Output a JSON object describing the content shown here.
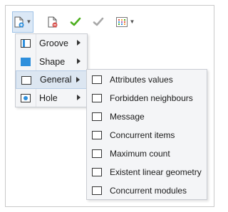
{
  "colors": {
    "accent": "#2e8fdc",
    "menu_bg": "#f4f5f7",
    "highlight": "#dce6f1",
    "check_green": "#4caf1e",
    "check_grey": "#a8a8a8"
  },
  "toolbar": {
    "buttons": [
      {
        "icon": "add-document-icon",
        "has_dropdown": true,
        "active": true
      },
      {
        "icon": "remove-document-icon",
        "has_dropdown": false
      },
      {
        "icon": "green-check-icon",
        "has_dropdown": false
      },
      {
        "icon": "grey-check-icon",
        "has_dropdown": false
      },
      {
        "icon": "grid-select-icon",
        "has_dropdown": true
      }
    ]
  },
  "menu": {
    "items": [
      {
        "label": "Groove",
        "icon": "groove-icon",
        "has_submenu": true
      },
      {
        "label": "Shape",
        "icon": "shape-icon",
        "has_submenu": true
      },
      {
        "label": "General",
        "icon": "general-icon",
        "has_submenu": true,
        "highlighted": true
      },
      {
        "label": "Hole",
        "icon": "hole-icon",
        "has_submenu": true
      }
    ]
  },
  "submenu": {
    "items": [
      {
        "label": "Attributes values",
        "icon": "rectangle-icon"
      },
      {
        "label": "Forbidden neighbours",
        "icon": "rectangle-icon"
      },
      {
        "label": "Message",
        "icon": "rectangle-icon"
      },
      {
        "label": "Concurrent items",
        "icon": "rectangle-icon"
      },
      {
        "label": "Maximum count",
        "icon": "rectangle-icon"
      },
      {
        "label": "Existent linear geometry",
        "icon": "rectangle-icon"
      },
      {
        "label": "Concurrent modules",
        "icon": "rectangle-icon"
      }
    ]
  }
}
